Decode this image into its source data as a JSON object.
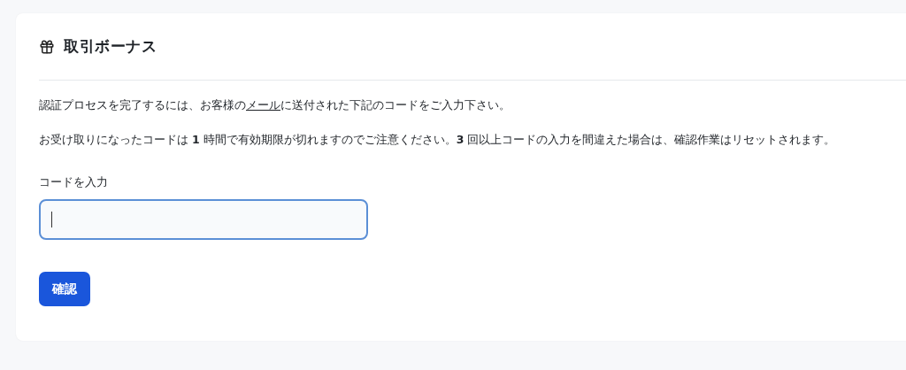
{
  "card": {
    "title": "取引ボーナス",
    "instruction": {
      "before": "認証プロセスを完了するには、お客様の",
      "link": "メール",
      "after": "に送付された下記のコードをご入力下さい。"
    },
    "notice": "お受け取りになったコードは **1** 時間で有効期限が切れますのでご注意ください。**3** 回以上コードの入力を間違えた場合は、確認作業はリセットされます。",
    "code_field": {
      "label": "コードを入力",
      "focused": true
    },
    "submit_button": "確認"
  }
}
